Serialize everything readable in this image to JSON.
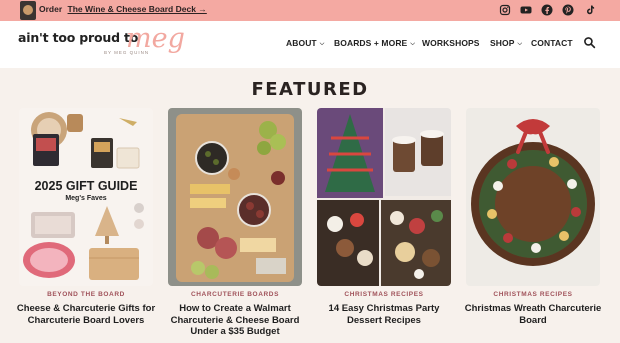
{
  "promo": {
    "prefix": "Order",
    "link": "The Wine & Cheese Board Deck →"
  },
  "social": [
    "instagram-icon",
    "youtube-icon",
    "facebook-icon",
    "pinterest-icon",
    "tiktok-icon"
  ],
  "logo": {
    "main": "ain't too proud to",
    "script": "meg",
    "by": "BY MEG QUINN"
  },
  "nav": {
    "about": "ABOUT",
    "boards": "BOARDS + MORE",
    "workshops": "WORKSHOPS",
    "shop": "SHOP",
    "contact": "CONTACT"
  },
  "featured": {
    "heading": "FEATURED",
    "cards": [
      {
        "category": "BEYOND THE BOARD",
        "title": "Cheese & Charcuterie Gifts for Charcuterie Board Lovers",
        "overlay_title": "2025 GIFT GUIDE",
        "overlay_sub": "Meg's Faves"
      },
      {
        "category": "CHARCUTERIE BOARDS",
        "title": "How to Create a Walmart Charcuterie & Cheese Board Under a $35 Budget"
      },
      {
        "category": "CHRISTMAS RECIPES",
        "title": "14 Easy Christmas Party Dessert Recipes"
      },
      {
        "category": "CHRISTMAS RECIPES",
        "title": "Christmas Wreath Charcuterie Board"
      }
    ]
  },
  "colors": {
    "promo_bg": "#f4a9a2",
    "page_bg": "#f7f1ec",
    "category": "#a0525a",
    "logo_script": "#f2a8a0"
  }
}
